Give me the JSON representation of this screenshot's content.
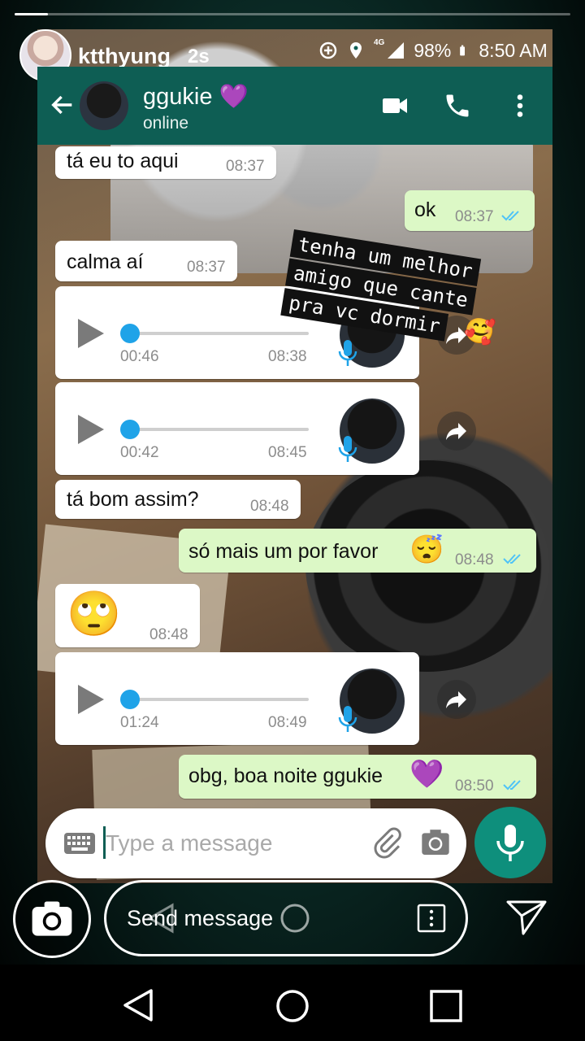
{
  "story": {
    "username": "ktthyung",
    "time_ago": "2s",
    "progress": 0.06
  },
  "status_bar": {
    "network": "4G",
    "battery": "98%",
    "clock": "8:50 AM"
  },
  "chat_header": {
    "contact_name": "ggukie",
    "name_emoji": "💜",
    "status": "online"
  },
  "messages": [
    {
      "type": "text",
      "dir": "in",
      "text": "tá eu to aqui",
      "time": "08:37"
    },
    {
      "type": "text",
      "dir": "out",
      "text": "ok",
      "time": "08:37",
      "read": true
    },
    {
      "type": "text",
      "dir": "in",
      "text": "calma aí",
      "time": "08:37"
    },
    {
      "type": "voice",
      "dir": "in",
      "duration": "00:46",
      "time": "08:38"
    },
    {
      "type": "voice",
      "dir": "in",
      "duration": "00:42",
      "time": "08:45"
    },
    {
      "type": "text",
      "dir": "in",
      "text": "tá bom assim?",
      "time": "08:48"
    },
    {
      "type": "text",
      "dir": "out",
      "text": "só mais um por favor",
      "emoji": "😴",
      "time": "08:48",
      "read": true
    },
    {
      "type": "emoji",
      "dir": "in",
      "emoji": "🙄",
      "time": "08:48"
    },
    {
      "type": "voice",
      "dir": "in",
      "duration": "01:24",
      "time": "08:49"
    },
    {
      "type": "text",
      "dir": "out",
      "text": "obg, boa noite ggukie",
      "emoji": "💜",
      "time": "08:50",
      "read": true
    }
  ],
  "sticker_text": {
    "lines": [
      "tenha um melhor",
      "amigo que cante",
      "pra vc dormir"
    ],
    "emoji": "🥰"
  },
  "input": {
    "placeholder": "Type a message"
  },
  "story_reply": {
    "placeholder": "Send message"
  },
  "colors": {
    "whatsapp_header": "#0e5e54",
    "outgoing_bubble": "#dcf8c6",
    "incoming_bubble": "#ffffff",
    "read_ticks": "#4fc3f7",
    "voice_dot": "#1fa3e8",
    "mic_fab": "#0e8f7c"
  }
}
